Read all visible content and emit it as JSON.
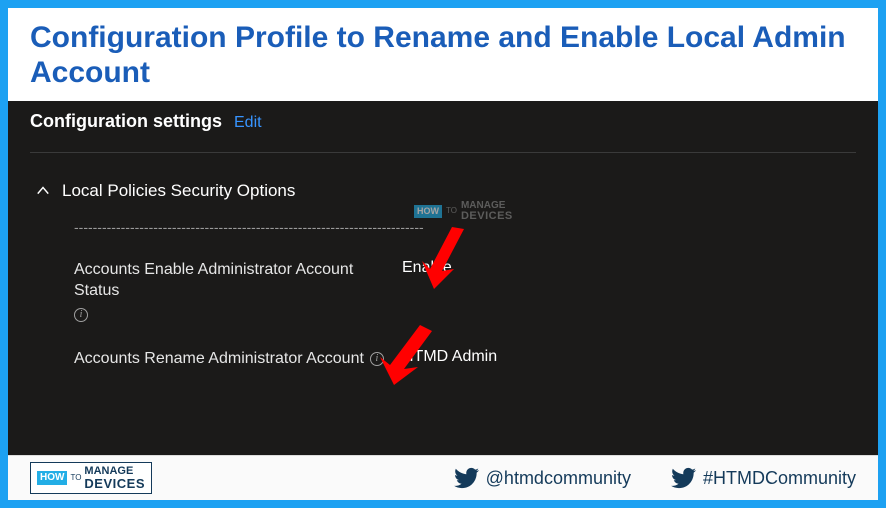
{
  "header": {
    "title": "Configuration Profile to Rename and Enable Local Admin Account"
  },
  "panel": {
    "title": "Configuration settings",
    "edit_label": "Edit",
    "section_title": "Local Policies Security Options",
    "dashes": "---------------------------------------------------------------------------",
    "settings": [
      {
        "label": "Accounts Enable Administrator Account Status",
        "value": "Enable"
      },
      {
        "label": "Accounts Rename Administrator Account",
        "value": "HTMD Admin"
      }
    ]
  },
  "watermark": {
    "how": "HOW",
    "to": "TO",
    "manage": "MANAGE",
    "devices": "DEVICES"
  },
  "footer": {
    "logo": {
      "how": "HOW",
      "to": "TO",
      "manage": "MANAGE",
      "devices": "DEVICES"
    },
    "handle1": "@htmdcommunity",
    "handle2": "#HTMDCommunity"
  }
}
